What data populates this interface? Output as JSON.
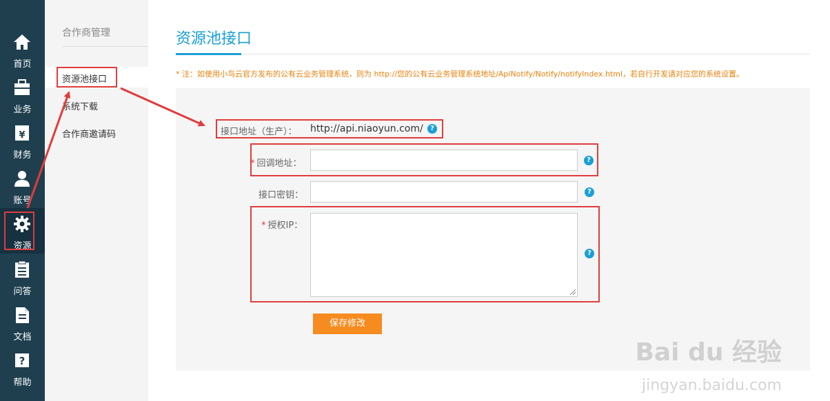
{
  "nav": {
    "items": [
      {
        "label": "首页",
        "icon": "home-icon"
      },
      {
        "label": "业务",
        "icon": "briefcase-icon"
      },
      {
        "label": "财务",
        "icon": "yuan-wallet-icon"
      },
      {
        "label": "账号",
        "icon": "user-icon"
      },
      {
        "label": "资源",
        "icon": "gear-icon"
      },
      {
        "label": "问答",
        "icon": "clipboard-icon"
      },
      {
        "label": "文档",
        "icon": "document-icon"
      },
      {
        "label": "帮助",
        "icon": "question-icon"
      }
    ],
    "active": "资源"
  },
  "subnav": {
    "title": "合作商管理",
    "items": [
      {
        "label": "资源池接口"
      },
      {
        "label": "系统下载"
      },
      {
        "label": "合作商邀请码"
      }
    ],
    "active": "资源池接口"
  },
  "main": {
    "title": "资源池接口",
    "notice": "* 注：如使用小鸟云官方发布的公有云业务管理系统，则为 http://您的公有云业务管理系统地址/ApiNotify/Notify/notifyIndex.html，若自行开发请对应您的系统设置。",
    "form": {
      "api_address_label": "接口地址（生产）：",
      "api_address_value": "http://api.niaoyun.com/",
      "callback_label": "回调地址：",
      "callback_value": "",
      "api_key_label": "接口密钥：",
      "api_key_value": "",
      "auth_ip_label": "授权IP：",
      "auth_ip_value": "",
      "required_mark": "*",
      "help_glyph": "?",
      "save_label": "保存修改"
    }
  },
  "watermark": {
    "brand": "Bai  du 经验",
    "url": "jingyan.baidu.com"
  },
  "colors": {
    "nav_bg": "#1f3f4f",
    "accent_blue": "#1a9fd6",
    "notice_orange": "#e8820c",
    "button_orange": "#f68b1f",
    "annotation_red": "#e23b3b"
  }
}
